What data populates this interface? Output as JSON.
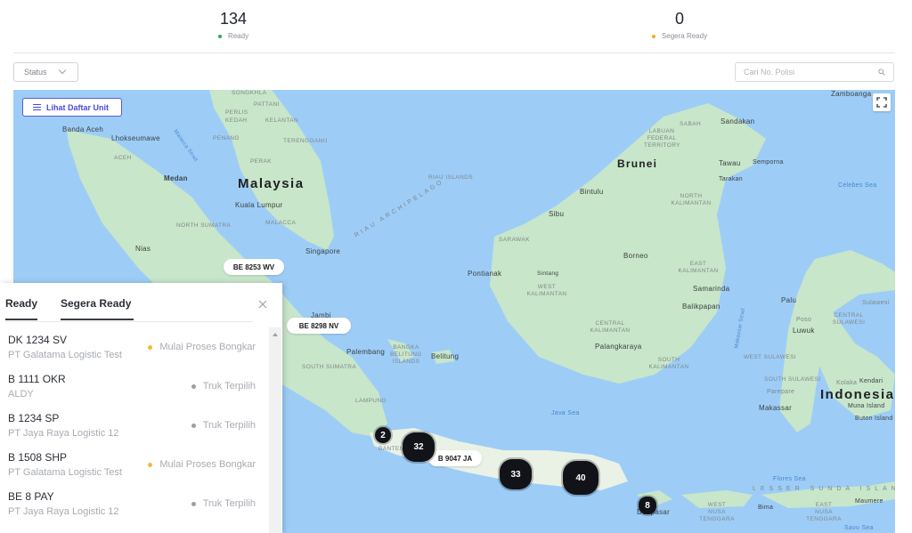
{
  "stats": {
    "ready": {
      "count": "134",
      "label": "Ready",
      "dot_color": "#2ea84a"
    },
    "segera_ready": {
      "count": "0",
      "label": "Segera Ready",
      "dot_color": "#f5a623"
    }
  },
  "filters": {
    "status_label": "Status",
    "search_placeholder": "Cari No. Polisi",
    "search_value": ""
  },
  "map": {
    "list_toggle_label": "Lihat Daftar Unit",
    "plate_markers": [
      {
        "label": "BE 8253 WV"
      },
      {
        "label": "BE 8298 NV"
      },
      {
        "label": "B 9047 JA"
      }
    ],
    "clusters": [
      {
        "count": "2"
      },
      {
        "count": "32"
      },
      {
        "count": "33"
      },
      {
        "count": "40"
      },
      {
        "count": "8"
      }
    ],
    "labels": {
      "countries": [
        "Malaysia",
        "Brunei",
        "Indonesia"
      ],
      "cities": [
        "Banda Aceh",
        "Lhokseumawe",
        "Medan",
        "Kuala Lumpur",
        "Singapore",
        "Nias",
        "Jambi",
        "Palembang",
        "Belitung",
        "Pontianak",
        "Sintang",
        "Bintulu",
        "Sibu",
        "Borneo",
        "Sandakan",
        "Tawau",
        "Semporna",
        "Tarakan",
        "Samarinda",
        "Balikpapan",
        "Palangkaraya",
        "Zamboanga",
        "Palu",
        "Poso",
        "Luwuk",
        "Sulawesi",
        "Kolaka",
        "Kendari",
        "Parepare",
        "Makassar",
        "Muna Island",
        "Buton Island",
        "Denpasar",
        "Bima",
        "Maumere"
      ],
      "regions": [
        "SONGKHLA",
        "PATTANI",
        "PERLIS",
        "KEDAH",
        "KELANTAN",
        "PENANG",
        "TERENGGANU",
        "PERAK",
        "MALACCA",
        "ACEH",
        "NORTH SUMATRA",
        "RIAU ISLANDS",
        "SOUTH SUMATRA",
        "BANGKA BELITUNG ISLANDS",
        "LAMPUNG",
        "BANTEN",
        "SABAH",
        "LABUAN FEDERAL TERRITORY",
        "SARAWAK",
        "NORTH KALIMANTAN",
        "EAST KALIMANTAN",
        "WEST KALIMANTAN",
        "CENTRAL KALIMANTAN",
        "SOUTH KALIMANTAN",
        "CENTRAL SULAWESI",
        "WEST SULAWESI",
        "SOUTH SULAWESI",
        "WEST NUSA TENGGARA",
        "EAST NUSA TENGGARA",
        "RIAU ARCHIPELAGO",
        "LESSER SUNDA ISLANDS"
      ],
      "seas": [
        "Malacca Strait",
        "Java Sea",
        "Celebes Sea",
        "Makassar Strait",
        "Flores Sea",
        "Savu Sea"
      ]
    }
  },
  "panel": {
    "tabs": [
      {
        "label": "Ready"
      },
      {
        "label": "Segera Ready"
      }
    ],
    "items": [
      {
        "plate": "DK 1234 SV",
        "company": "PT Galatama Logistic Test",
        "status": "Mulai Proses Bongkar",
        "dot_color": "#f5b93a"
      },
      {
        "plate": "B 1111 OKR",
        "company": "ALDY",
        "status": "Truk Terpilih",
        "dot_color": "#9a9ea5"
      },
      {
        "plate": "B 1234 SP",
        "company": "PT Jaya Raya Logistic 12",
        "status": "Truk Terpilih",
        "dot_color": "#9a9ea5"
      },
      {
        "plate": "B 1508 SHP",
        "company": "PT Galatama Logistic Test",
        "status": "Mulai Proses Bongkar",
        "dot_color": "#f5b93a"
      },
      {
        "plate": "BE 8 PAY",
        "company": "PT Jaya Raya Logistic 12",
        "status": "Truk Terpilih",
        "dot_color": "#9a9ea5"
      }
    ]
  }
}
